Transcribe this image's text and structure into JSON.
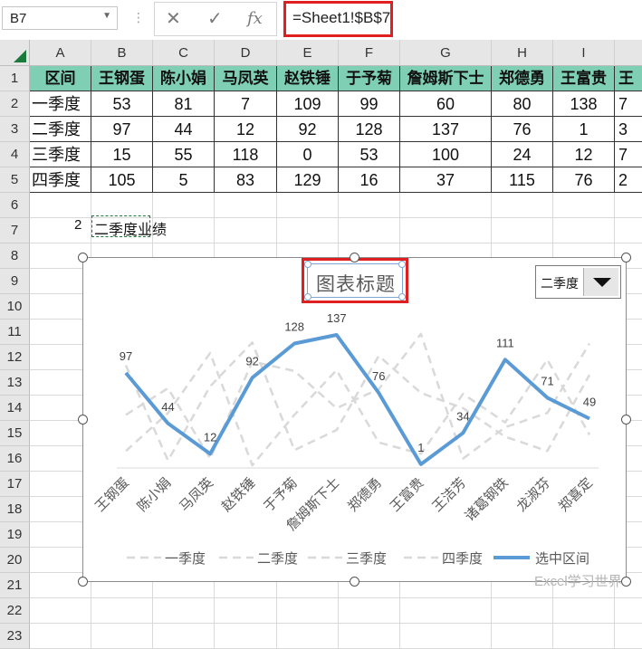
{
  "namebox": {
    "value": "B7"
  },
  "formula_bar": {
    "formula": "=Sheet1!$B$7",
    "cancel_icon": "close-icon",
    "enter_icon": "check-icon",
    "fx": "fx"
  },
  "columns": [
    "A",
    "B",
    "C",
    "D",
    "E",
    "F",
    "G",
    "H",
    "I"
  ],
  "rows": [
    "1",
    "2",
    "3",
    "4",
    "5",
    "6",
    "7",
    "8",
    "9",
    "10",
    "11",
    "12",
    "13",
    "14",
    "15",
    "16",
    "17",
    "18",
    "19",
    "20",
    "21",
    "22",
    "23"
  ],
  "table": {
    "header": [
      "区间",
      "王钢蛋",
      "陈小娟",
      "马凤英",
      "赵铁锤",
      "于予菊",
      "詹姆斯下士",
      "郑德勇",
      "王富贵",
      "王"
    ],
    "rows": [
      [
        "一季度",
        "53",
        "81",
        "7",
        "109",
        "99",
        "60",
        "80",
        "138",
        "7"
      ],
      [
        "二季度",
        "97",
        "44",
        "12",
        "92",
        "128",
        "137",
        "76",
        "1",
        "3"
      ],
      [
        "三季度",
        "15",
        "55",
        "118",
        "0",
        "53",
        "100",
        "24",
        "12",
        "7"
      ],
      [
        "四季度",
        "105",
        "5",
        "83",
        "129",
        "16",
        "37",
        "115",
        "76",
        "2"
      ]
    ]
  },
  "row7": {
    "a7": "2",
    "b7": "二季度业绩"
  },
  "chart": {
    "title": "图表标题",
    "dropdown_value": "二季度"
  },
  "chart_data": {
    "type": "line",
    "title": "图表标题",
    "categories": [
      "王钢蛋",
      "陈小娟",
      "马凤英",
      "赵铁锤",
      "于予菊",
      "詹姆斯下士",
      "郑德勇",
      "王富贵",
      "王洁芳",
      "诸葛钢铁",
      "龙淑芬",
      "郑喜定"
    ],
    "ylim": [
      0,
      145
    ],
    "series": [
      {
        "name": "一季度",
        "style": "dashed",
        "color": "#d9d9d9",
        "values": [
          53,
          81,
          7,
          109,
          99,
          60,
          80,
          138,
          7,
          40,
          55,
          128
        ]
      },
      {
        "name": "二季度",
        "style": "dashed",
        "color": "#d9d9d9",
        "values": [
          97,
          44,
          12,
          92,
          128,
          137,
          76,
          1,
          34,
          111,
          71,
          49
        ]
      },
      {
        "name": "三季度",
        "style": "dashed",
        "color": "#d9d9d9",
        "values": [
          15,
          55,
          118,
          0,
          53,
          100,
          24,
          12,
          75,
          45,
          111,
          32
        ]
      },
      {
        "name": "四季度",
        "style": "dashed",
        "color": "#d9d9d9",
        "values": [
          105,
          5,
          83,
          129,
          16,
          37,
          115,
          76,
          60,
          30,
          15,
          95
        ]
      },
      {
        "name": "选中区间",
        "style": "solid",
        "color": "#5b9bd5",
        "values": [
          97,
          44,
          12,
          92,
          128,
          137,
          76,
          1,
          34,
          111,
          71,
          49
        ]
      }
    ],
    "data_labels": "选中区间",
    "legend": "bottom",
    "grid": false
  },
  "watermark": "Excel学习世界"
}
